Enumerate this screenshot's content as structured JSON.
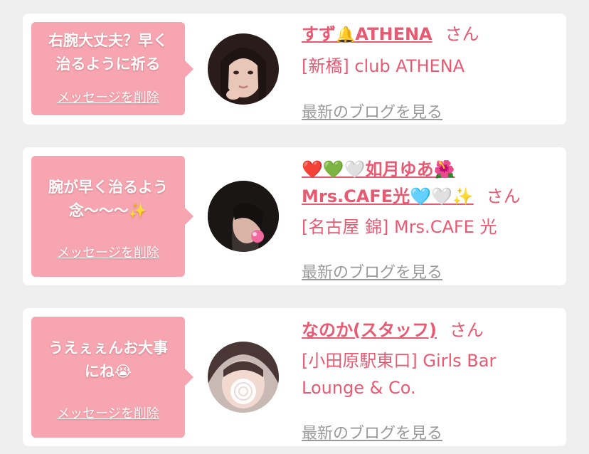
{
  "cards": [
    {
      "message_lines": [
        "右腕大丈夫？早く",
        "治るように祈る"
      ],
      "delete_label": "メッセージを削除",
      "name_prefix": "すず",
      "name_emoji": "🔔",
      "name_suffix": "ATHENA",
      "honorific": "さん",
      "shop": "[新橋] club ATHENA",
      "blog_label": "最新のブログを見る"
    },
    {
      "message_lines": [
        "腕が早く治るよう",
        "念〜〜〜✨"
      ],
      "delete_label": "メッセージを削除",
      "name_line1": "❤️💚🤍如月ゆあ🌺",
      "name_line2": "Mrs.CAFE光🩵🤍✨",
      "honorific": "さん",
      "shop": "[名古屋 錦] Mrs.CAFE 光",
      "blog_label": "最新のブログを見る"
    },
    {
      "message_lines": [
        "うえぇぇんお大事",
        "にね😭"
      ],
      "delete_label": "メッセージを削除",
      "name": "なのか(スタッフ)",
      "honorific": "さん",
      "shop_line1": "[小田原駅東口] Girls Bar",
      "shop_line2": "Lounge & Co.",
      "blog_label": "最新のブログを見る"
    }
  ],
  "colors": {
    "bubble": "#f7a6b1",
    "accent": "#e85a72",
    "muted": "#999999",
    "card": "#ffffff",
    "background": "#efefef"
  }
}
